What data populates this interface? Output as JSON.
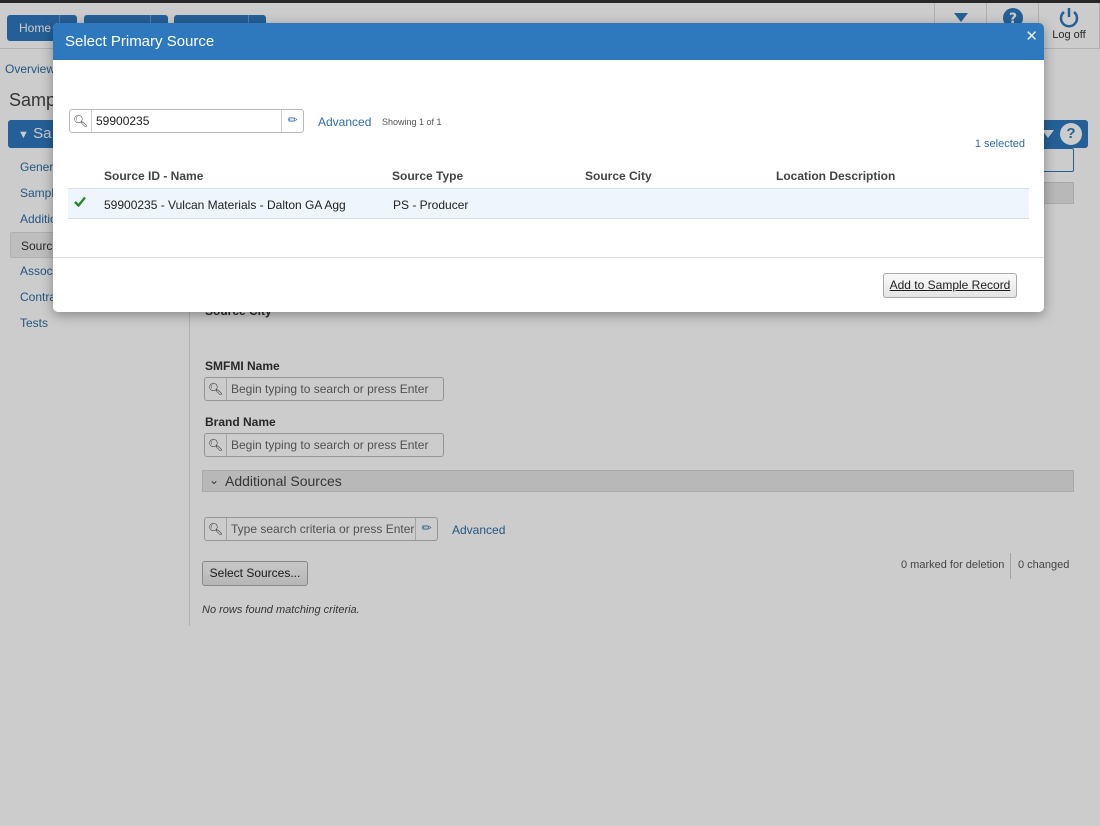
{
  "topbar": {
    "home_label": "Home",
    "nav2_label": "",
    "nav3_label": "",
    "logoff_label": "Log off"
  },
  "breadcrumb": {
    "overview": "Overview"
  },
  "page": {
    "title": "Samp"
  },
  "panel": {
    "title": "Sa"
  },
  "leftnav": {
    "items": [
      {
        "label": "Genera"
      },
      {
        "label": "Sample"
      },
      {
        "label": "Additio"
      },
      {
        "label": "Source"
      },
      {
        "label": "Associ"
      },
      {
        "label": "Contra"
      },
      {
        "label": "Tests"
      }
    ]
  },
  "form": {
    "source_city_label": "Source City",
    "smfmi_label": "SMFMI Name",
    "smfmi_placeholder": "Begin typing to search or press Enter",
    "brand_label": "Brand Name",
    "brand_placeholder": "Begin typing to search or press Enter",
    "additional_sources_label": "Additional Sources",
    "additional_search_placeholder": "Type search criteria or press Enter",
    "advanced_label": "Advanced",
    "select_sources_label": "Select Sources...",
    "marked_for_deletion": "0 marked for deletion",
    "changed": "0 changed",
    "no_rows": "No rows found matching criteria."
  },
  "modal": {
    "title": "Select Primary Source",
    "search_value": "59900235",
    "advanced_label": "Advanced",
    "showing": "Showing 1 of 1",
    "selected_count": "1 selected",
    "columns": [
      "Source ID - Name",
      "Source Type",
      "Source City",
      "Location Description"
    ],
    "rows": [
      {
        "id_name": "59900235 - Vulcan Materials - Dalton GA Agg",
        "type": "PS - Producer",
        "city": "",
        "location": ""
      }
    ],
    "add_button_label": "Add to Sample Record"
  },
  "colors": {
    "primary": "#2e78bd",
    "link": "#2e6da4",
    "check": "#2a8a2a"
  }
}
